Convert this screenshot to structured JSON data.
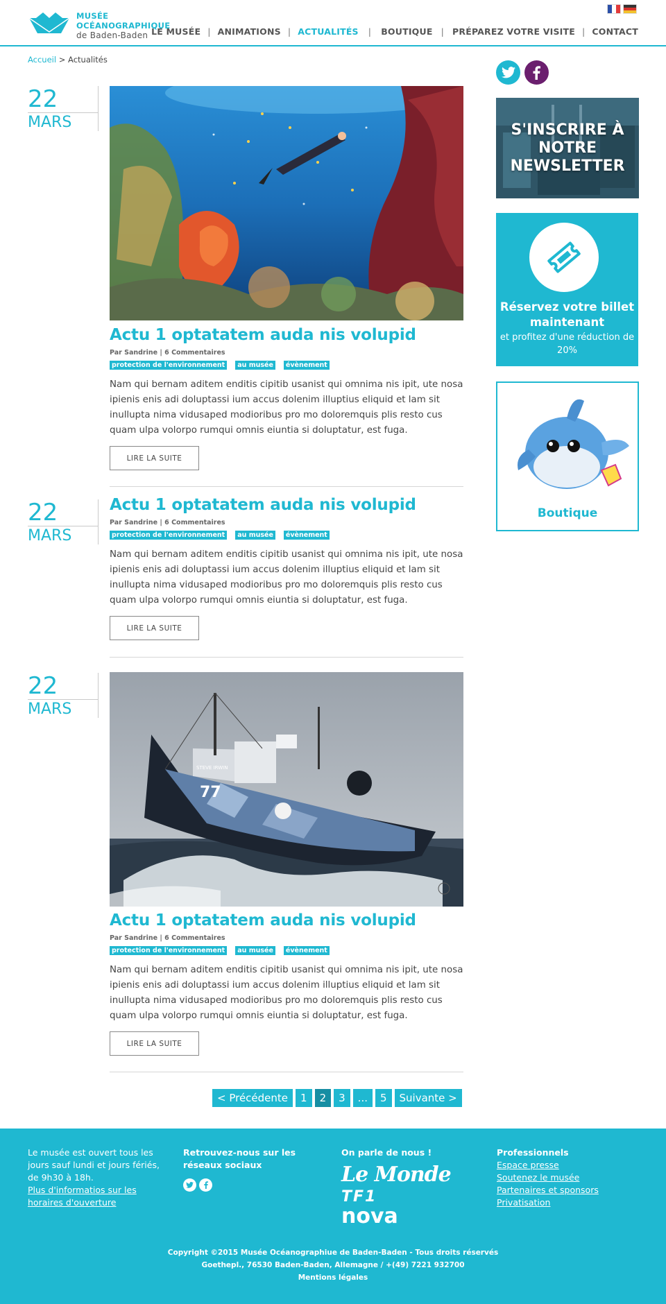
{
  "header": {
    "logo": {
      "line1": "MUSÉE",
      "line2": "OCÉANOGRAPHIQUE",
      "line3": "de Baden-Baden"
    },
    "flags": [
      "french-flag",
      "german-flag"
    ],
    "nav": [
      "LE MUSÉE",
      "ANIMATIONS",
      "ACTUALITÉS",
      "BOUTIQUE",
      "PRÉPAREZ VOTRE VISITE",
      "CONTACT"
    ],
    "active_nav": "ACTUALITÉS"
  },
  "breadcrumb": {
    "home": "Accueil",
    "separator": ">",
    "current": "Actualités"
  },
  "articles": [
    {
      "day": "22",
      "month": "MARS",
      "image": "coral-reef-diver-photo",
      "title": "Actu 1 optatatem auda nis volupid",
      "meta": "Par Sandrine | 6 Commentaires",
      "tags": [
        "protection de l'environnement",
        "au musée",
        "évènement"
      ],
      "excerpt": "Nam qui bernam aditem enditis cipitib usanist qui omnima nis ipit, ute nosa ipienis enis adi doluptassi ium accus dolenim illuptius eliquid et lam sit inullupta nima vidusaped modioribus pro mo doloremquis plis resto cus quam ulpa volorpo rumqui omnis eiuntia si doluptatur, est fuga.",
      "button": "LIRE LA SUITE"
    },
    {
      "day": "22",
      "month": "MARS",
      "title": "Actu 1 optatatem auda nis volupid",
      "meta": "Par Sandrine | 6 Commentaires",
      "tags": [
        "protection de l'environnement",
        "au musée",
        "évènement"
      ],
      "excerpt": "Nam qui bernam aditem enditis cipitib usanist qui omnima nis ipit, ute nosa ipienis enis adi doluptassi ium accus dolenim illuptius eliquid et lam sit inullupta nima vidusaped modioribus pro mo doloremquis plis resto cus quam ulpa volorpo rumqui omnis eiuntia si doluptatur, est fuga.",
      "button": "LIRE LA SUITE"
    },
    {
      "day": "22",
      "month": "MARS",
      "image": "ship-at-sea-photo",
      "ship_name": "STEVE IRWIN",
      "ship_number": "77",
      "title": "Actu 1 optatatem auda nis volupid",
      "meta": "Par Sandrine | 6 Commentaires",
      "tags": [
        "protection de l'environnement",
        "au musée",
        "évènement"
      ],
      "excerpt": "Nam qui bernam aditem enditis cipitib usanist qui omnima nis ipit, ute nosa ipienis enis adi doluptassi ium accus dolenim illuptius eliquid et lam sit inullupta nima vidusaped modioribus pro mo doloremquis plis resto cus quam ulpa volorpo rumqui omnis eiuntia si doluptatur, est fuga.",
      "button": "LIRE LA SUITE"
    }
  ],
  "pagination": {
    "prev": "< Précédente",
    "pages": [
      "1",
      "2",
      "3",
      "...",
      "5"
    ],
    "current": "2",
    "next": "Suivante >"
  },
  "sidebar": {
    "social": [
      "twitter-icon",
      "facebook-icon"
    ],
    "newsletter": "S'INSCRIRE À NOTRE NEWSLETTER",
    "ticket": {
      "title": "Réservez votre billet maintenant",
      "subtitle": "et profitez d'une réduction de 20%"
    },
    "shop": {
      "label": "Boutique",
      "image": "dolphin-plush-toy"
    }
  },
  "footer": {
    "hours": "Le musée est ouvert tous les jours sauf lundi et jours fériés, de 9h30 à 18h.",
    "hours_link": "Plus d'informatios sur les horaires d'ouverture",
    "social_heading": "Retrouvez-nous sur les réseaux sociaux",
    "press_heading": "On parle de nous !",
    "press": [
      "Le Monde",
      "TF1",
      "nova"
    ],
    "pro_heading": "Professionnels",
    "pro_links": [
      "Espace presse",
      "Soutenez le musée",
      "Partenaires et sponsors",
      "Privatisation"
    ],
    "copyright": "Copyright ©2015 Musée Océanographiue de Baden-Baden - Tous droits réservés",
    "address": "Goethepl., 76530 Baden-Baden, Allemagne / +(49) 7221 932700",
    "legal": "Mentions légales"
  },
  "colors": {
    "accent": "#1fb8d1",
    "accent_dark": "#168ea3",
    "facebook_circle": "#6b1f6e",
    "text": "#444444"
  }
}
